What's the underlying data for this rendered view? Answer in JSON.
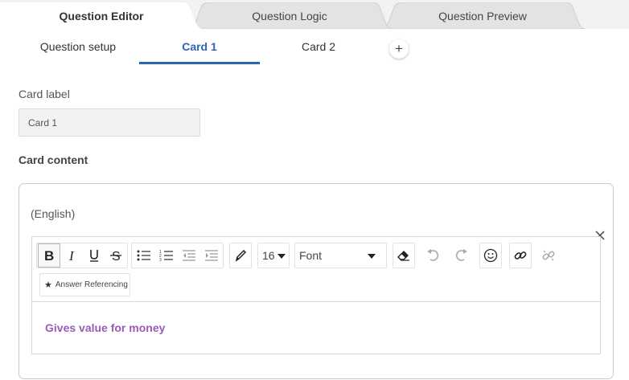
{
  "top_tabs": [
    {
      "label": "Question Editor",
      "active": true
    },
    {
      "label": "Question Logic",
      "active": false
    },
    {
      "label": "Question Preview",
      "active": false
    }
  ],
  "sub_tabs": [
    {
      "label": "Question setup",
      "active": false
    },
    {
      "label": "Card 1",
      "active": true
    },
    {
      "label": "Card 2",
      "active": false
    }
  ],
  "add_tab_symbol": "+",
  "card_label": {
    "label": "Card label",
    "value": "Card 1"
  },
  "card_content": {
    "label": "Card content",
    "language": "(English)",
    "toolbar": {
      "font_size": "16",
      "font": "Font",
      "answer_referencing": "Answer Referencing",
      "icons": [
        "bold-icon",
        "italic-icon",
        "underline-icon",
        "strikethrough-icon",
        "bulleted-list-icon",
        "numbered-list-icon",
        "decrease-indent-icon",
        "increase-indent-icon",
        "text-color-icon",
        "clear-formatting-icon",
        "undo-icon",
        "redo-icon",
        "emoji-icon",
        "link-icon",
        "unlink-icon",
        "star-icon",
        "close-icon"
      ]
    },
    "text": "Gives value for money",
    "text_color": "#9a5ab5"
  },
  "colors": {
    "accent": "#2e64b4",
    "tab_bg": "#e3e3e3",
    "strip_bg": "#f2f2f2"
  }
}
